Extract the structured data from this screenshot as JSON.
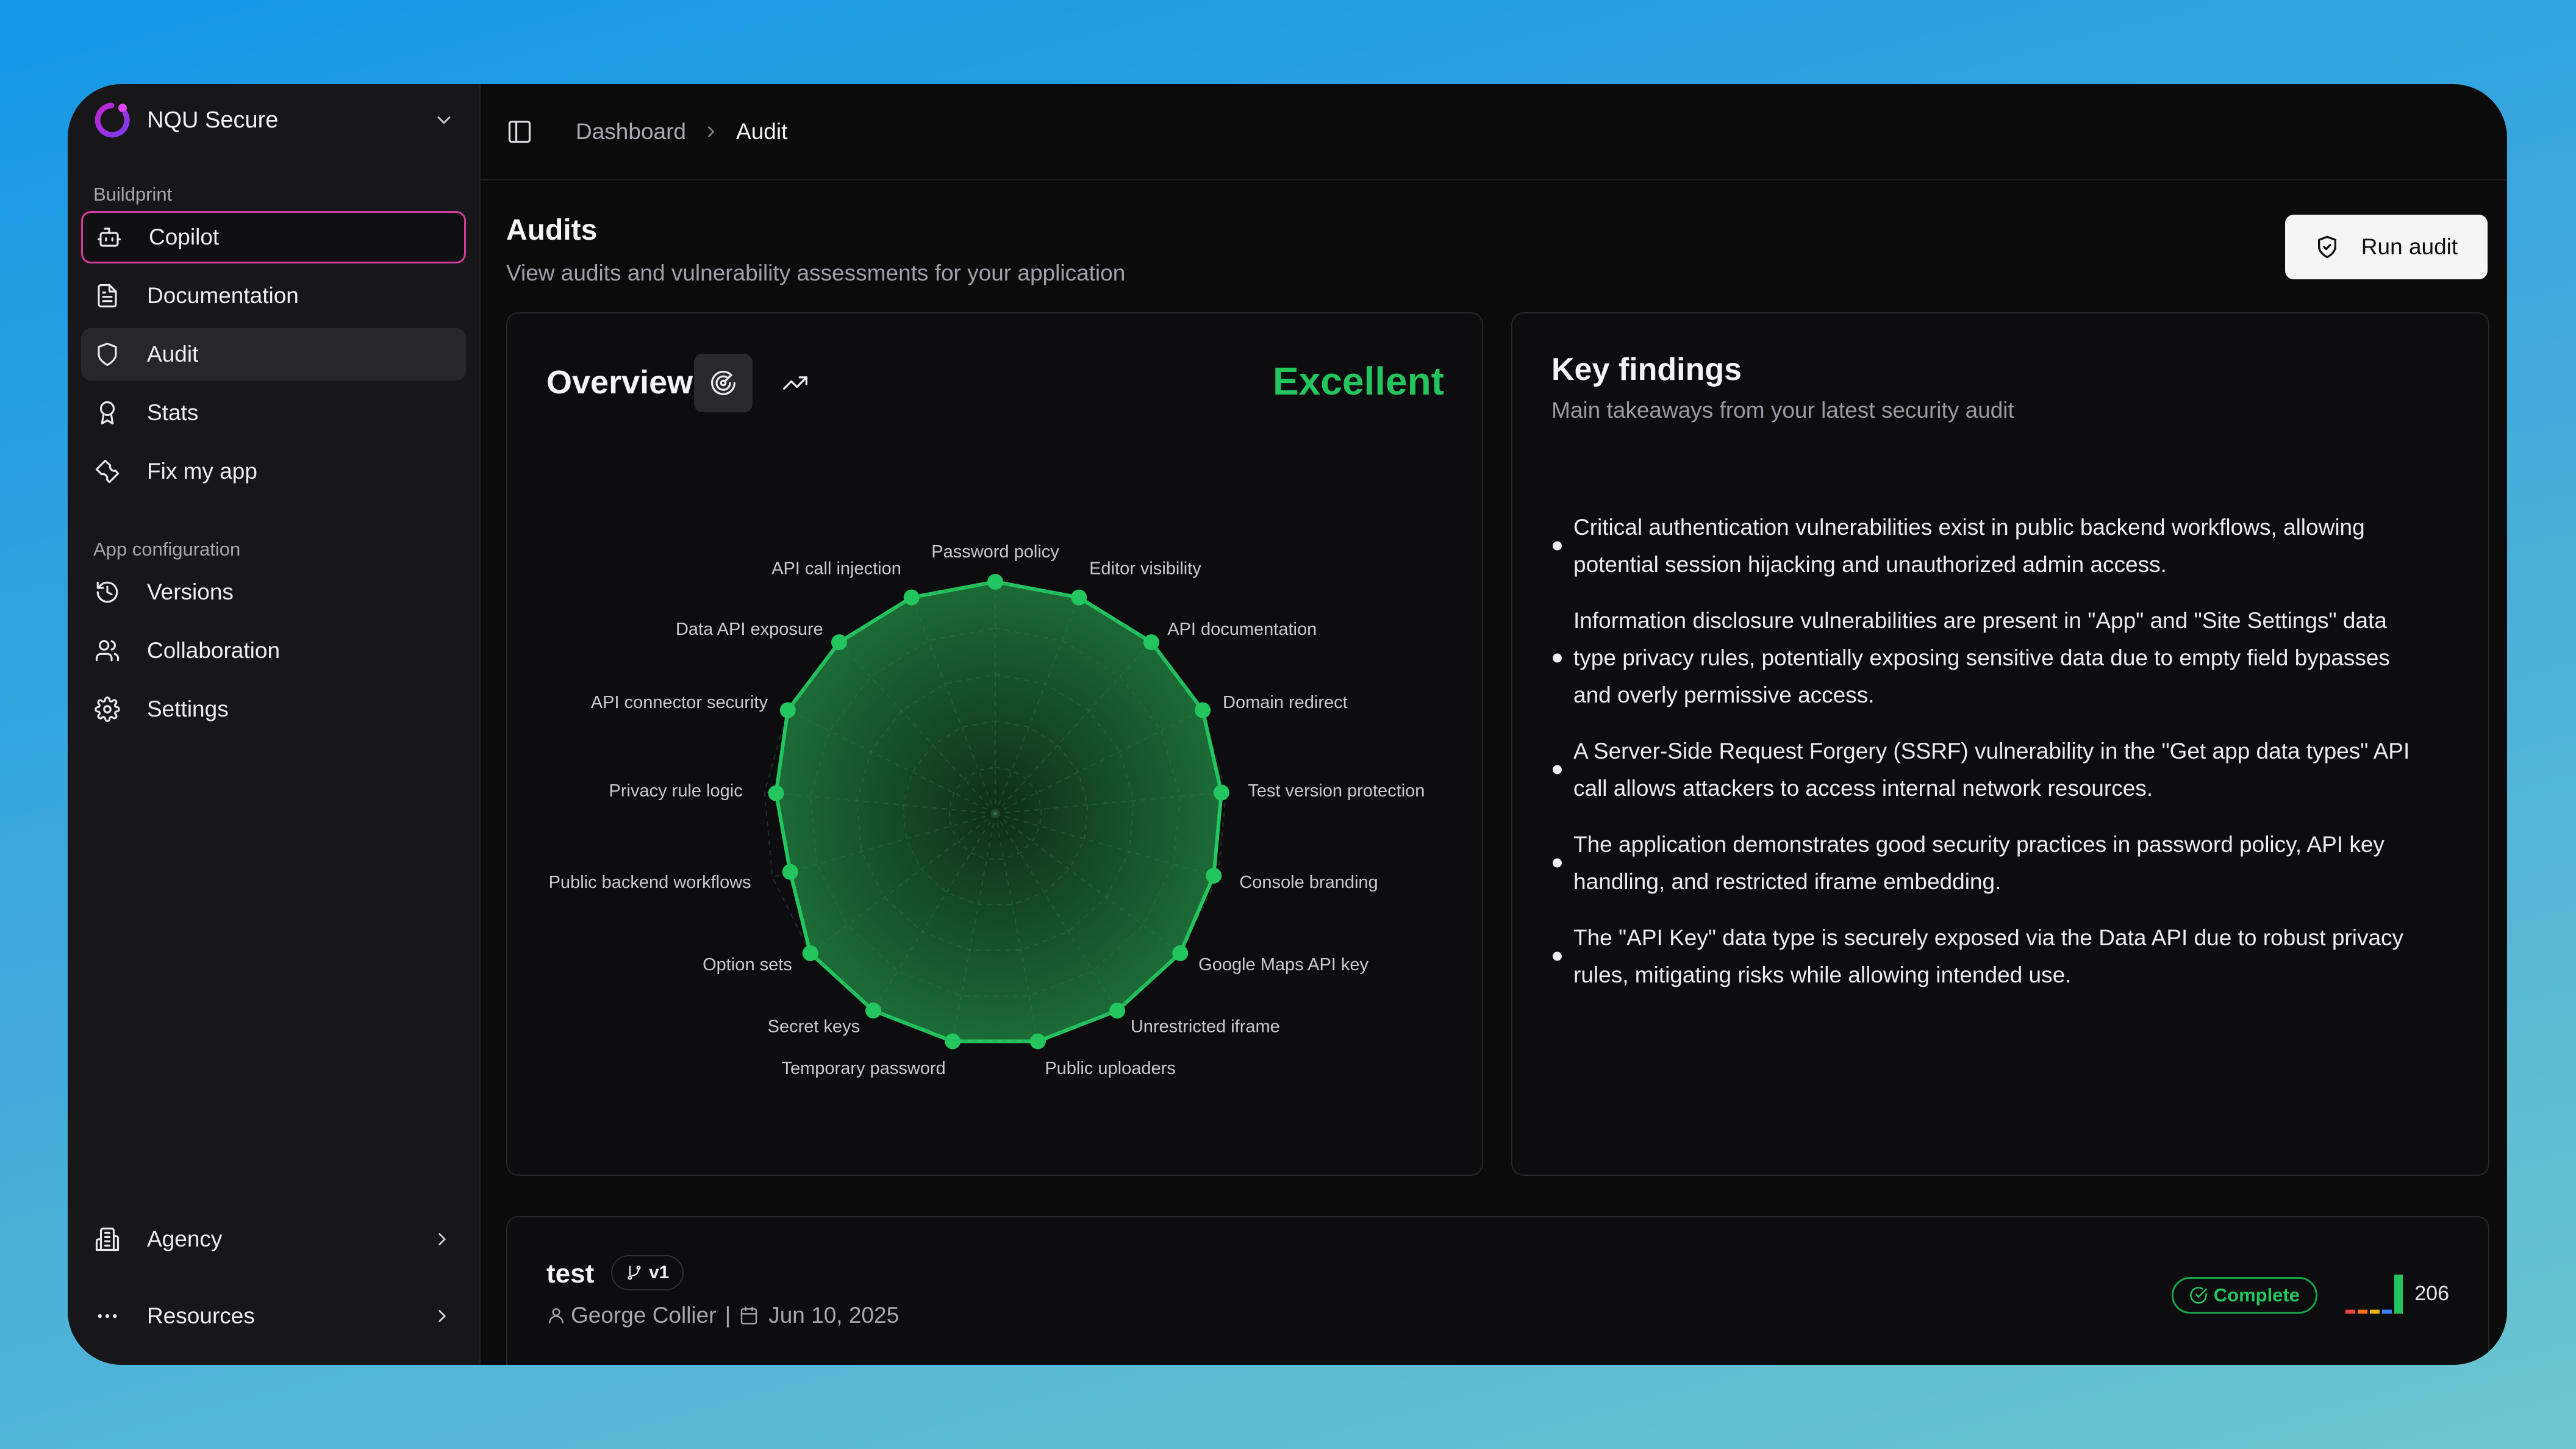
{
  "sidebar": {
    "brand": "NQU Secure",
    "sections": [
      {
        "label": "Buildprint"
      },
      {
        "label": "App configuration"
      }
    ],
    "items": [
      {
        "label": "Copilot",
        "icon": "bot-icon"
      },
      {
        "label": "Documentation",
        "icon": "document-icon"
      },
      {
        "label": "Audit",
        "icon": "shield-icon"
      },
      {
        "label": "Stats",
        "icon": "award-icon"
      },
      {
        "label": "Fix my app",
        "icon": "wrench-icon"
      },
      {
        "label": "Versions",
        "icon": "history-icon"
      },
      {
        "label": "Collaboration",
        "icon": "users-icon"
      },
      {
        "label": "Settings",
        "icon": "gear-icon"
      }
    ],
    "bottom": [
      {
        "label": "Agency",
        "icon": "building-icon"
      },
      {
        "label": "Resources",
        "icon": "more-icon"
      }
    ]
  },
  "breadcrumb": [
    "Dashboard",
    "Audit"
  ],
  "page": {
    "title": "Audits",
    "subtitle": "View audits and vulnerability assessments for your application",
    "run_button": "Run audit"
  },
  "overview": {
    "title": "Overview",
    "rating": "Excellent"
  },
  "chart_data": {
    "type": "radar",
    "categories": [
      "Password policy",
      "Editor visibility",
      "API documentation",
      "Domain redirect",
      "Test version protection",
      "Console branding",
      "Google Maps API key",
      "Unrestricted iframe",
      "Public uploaders",
      "Temporary password",
      "Secret keys",
      "Option sets",
      "Public backend workflows",
      "Privacy rule logic",
      "API connector security",
      "Data API exposure",
      "API call injection"
    ],
    "values": [
      100,
      100,
      100,
      100,
      98,
      98,
      100,
      100,
      100,
      100,
      100,
      100,
      92,
      95,
      100,
      100,
      100
    ],
    "range": [
      0,
      100
    ],
    "color": "#22c55e"
  },
  "findings": {
    "title": "Key findings",
    "subtitle": "Main takeaways from your latest security audit",
    "items": [
      "Critical authentication vulnerabilities exist in public backend workflows, allowing potential session hijacking and unauthorized admin access.",
      "Information disclosure vulnerabilities are present in \"App\" and \"Site Settings\" data type privacy rules, potentially exposing sensitive data due to empty field bypasses and overly permissive access.",
      "A Server-Side Request Forgery (SSRF) vulnerability in the \"Get app data types\" API call allows attackers to access internal network resources.",
      "The application demonstrates good security practices in password policy, API key handling, and restricted iframe embedding.",
      "The \"API Key\" data type is securely exposed via the Data API due to robust privacy rules, mitigating risks while allowing intended use."
    ]
  },
  "audit": {
    "name": "test",
    "version": "v1",
    "author": "George Collier",
    "separator": "|",
    "date": "Jun 10, 2025",
    "status": "Complete",
    "score": "206",
    "spark": [
      {
        "value": 1,
        "color": "#ef4444"
      },
      {
        "value": 1,
        "color": "#f97316"
      },
      {
        "value": 1,
        "color": "#eab308"
      },
      {
        "value": 1,
        "color": "#3b82f6"
      },
      {
        "value": 10,
        "color": "#22c55e"
      }
    ]
  },
  "colors": {
    "accent": "#22c55e",
    "selected_border": "#d23b9f"
  }
}
